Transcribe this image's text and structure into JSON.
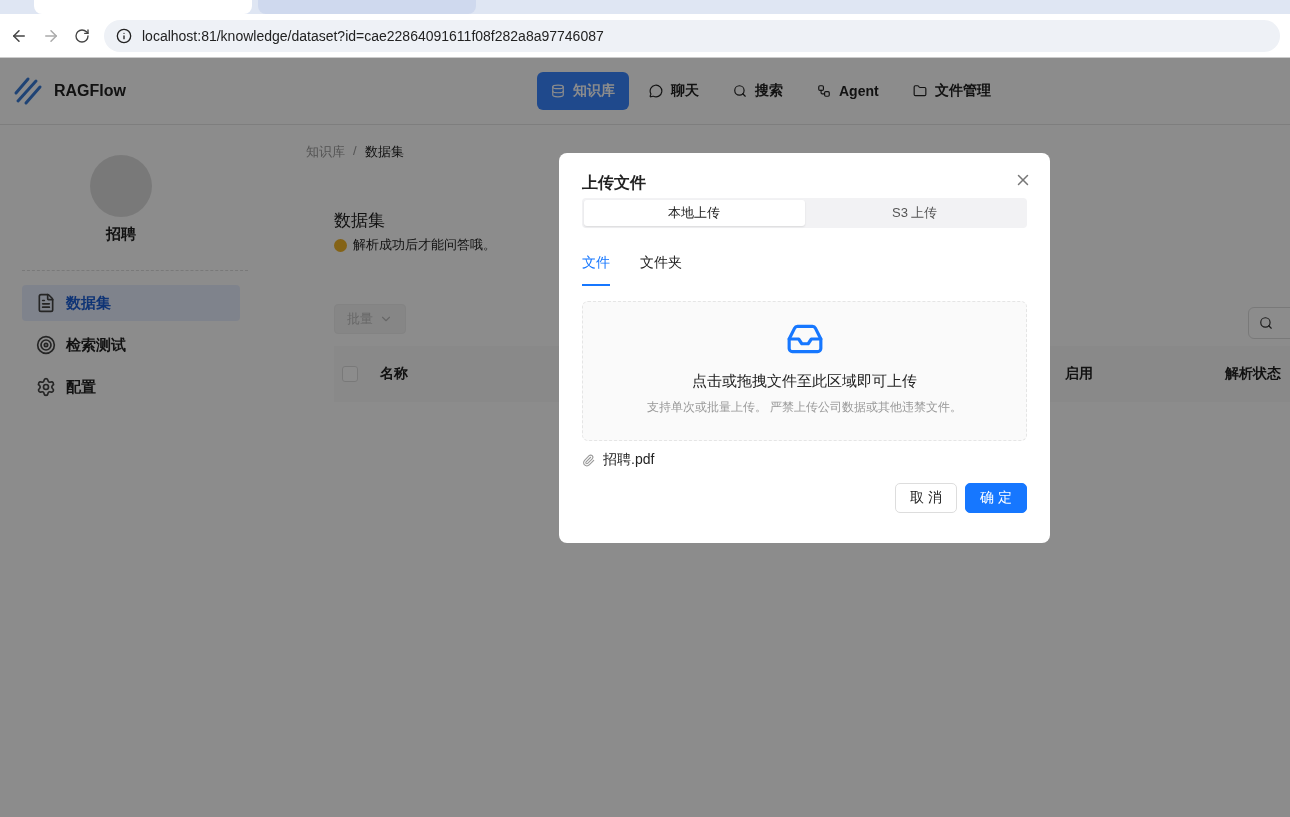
{
  "browser": {
    "tabs": [
      {
        "selected": true
      },
      {
        "selected": false
      }
    ],
    "address": "localhost:81/knowledge/dataset?id=cae22864091611f08f282a8a97746087"
  },
  "header": {
    "brand": "RAGFlow",
    "nav": [
      {
        "label": "知识库",
        "selected": true
      },
      {
        "label": "聊天",
        "selected": false
      },
      {
        "label": "搜索",
        "selected": false
      },
      {
        "label": "Agent",
        "selected": false
      },
      {
        "label": "文件管理",
        "selected": false
      }
    ]
  },
  "sidebar": {
    "name": "招聘",
    "items": [
      {
        "label": "数据集",
        "selected": true
      },
      {
        "label": "检索测试",
        "selected": false
      },
      {
        "label": "配置",
        "selected": false
      }
    ]
  },
  "breadcrumb": {
    "items": [
      "知识库",
      "数据集"
    ],
    "separator": "/"
  },
  "page": {
    "title": "数据集",
    "subtitle": "解析成功后才能问答哦。",
    "batch_button": "批量"
  },
  "table": {
    "select_all_checked": false,
    "columns": [
      "名称",
      "启用",
      "解析状态"
    ]
  },
  "modal": {
    "title": "上传文件",
    "segments": [
      {
        "label": "本地上传",
        "selected": true
      },
      {
        "label": "S3 上传",
        "selected": false
      }
    ],
    "tabs": [
      {
        "label": "文件",
        "selected": true
      },
      {
        "label": "文件夹",
        "selected": false
      }
    ],
    "dropzone": {
      "text": "点击或拖拽文件至此区域即可上传",
      "hint": "支持单次或批量上传。 严禁上传公司数据或其他违禁文件。"
    },
    "files": [
      "招聘.pdf"
    ],
    "buttons": {
      "cancel": "取 消",
      "ok": "确 定"
    }
  }
}
